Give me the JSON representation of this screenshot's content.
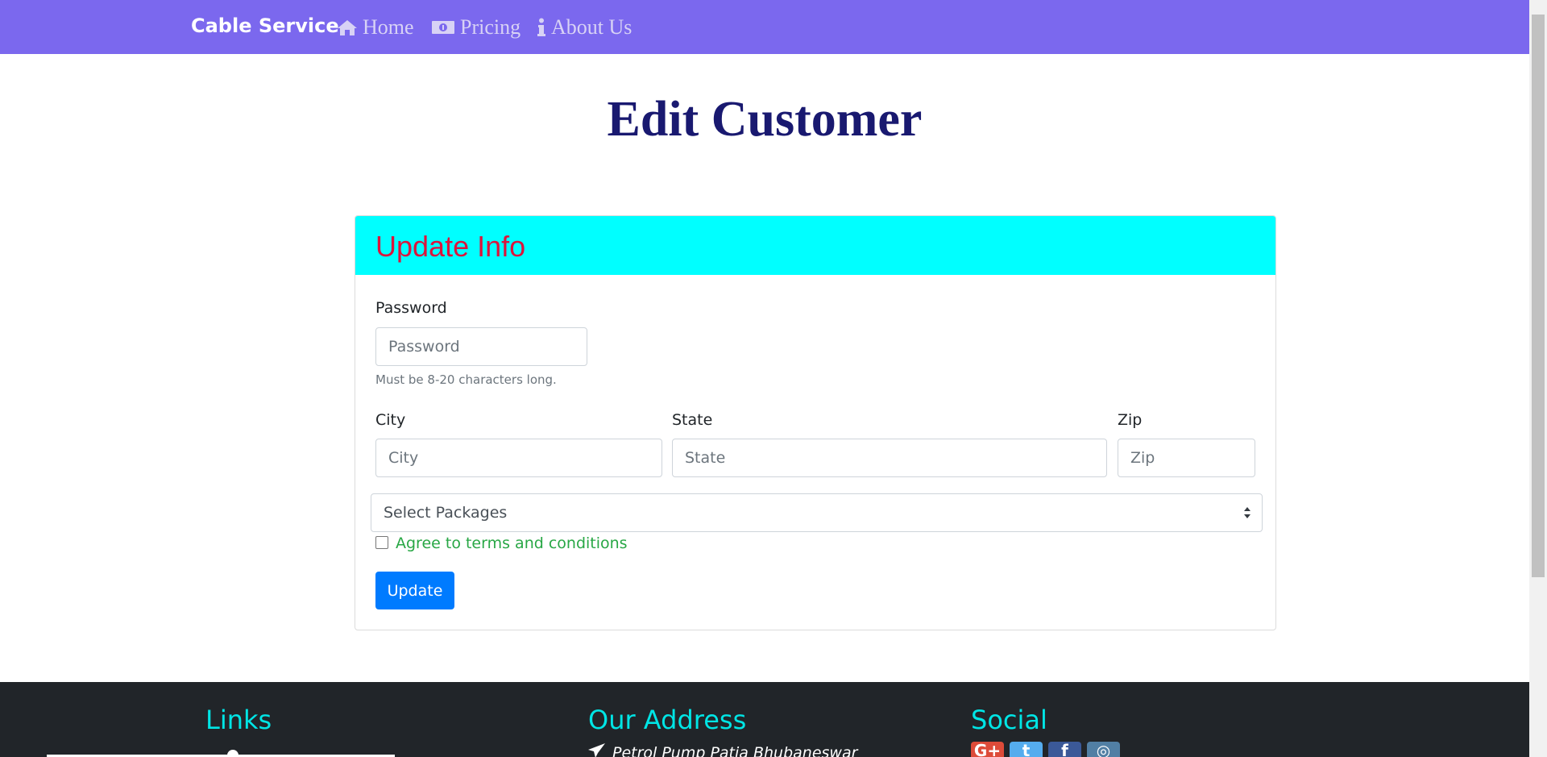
{
  "nav": {
    "brand": "Cable Service",
    "items": [
      {
        "label": "Home",
        "icon": "home-icon"
      },
      {
        "label": "Pricing",
        "icon": "money-icon"
      },
      {
        "label": "About Us",
        "icon": "info-icon"
      }
    ]
  },
  "page": {
    "title": "Edit Customer"
  },
  "form": {
    "header": "Update Info",
    "password": {
      "label": "Password",
      "placeholder": "Password",
      "help": "Must be 8-20 characters long."
    },
    "city": {
      "label": "City",
      "placeholder": "City"
    },
    "state": {
      "label": "State",
      "placeholder": "State"
    },
    "zip": {
      "label": "Zip",
      "placeholder": "Zip"
    },
    "packages": {
      "selected": "Select Packages"
    },
    "terms": {
      "label": "Agree to terms and conditions",
      "checked": false
    },
    "submit": "Update"
  },
  "footer": {
    "links_heading": "Links",
    "address_heading": "Our Address",
    "address_line": "Petrol Pump Patia Bhubaneswar",
    "social_heading": "Social",
    "social": [
      {
        "name": "google-plus-icon",
        "color": "#dd4b39",
        "glyph": "G+"
      },
      {
        "name": "twitter-icon",
        "color": "#55acee",
        "glyph": "t"
      },
      {
        "name": "facebook-icon",
        "color": "#3b5998",
        "glyph": "f"
      },
      {
        "name": "instagram-icon",
        "color": "#517fa4",
        "glyph": "◎"
      }
    ]
  },
  "colors": {
    "navbar": "#7b68ee",
    "title": "#191970",
    "card_header": "#00ffff",
    "card_title": "#dc143c",
    "terms": "#28a745",
    "button": "#007bff",
    "footer": "#212529",
    "footer_heading": "#00e5e5"
  }
}
